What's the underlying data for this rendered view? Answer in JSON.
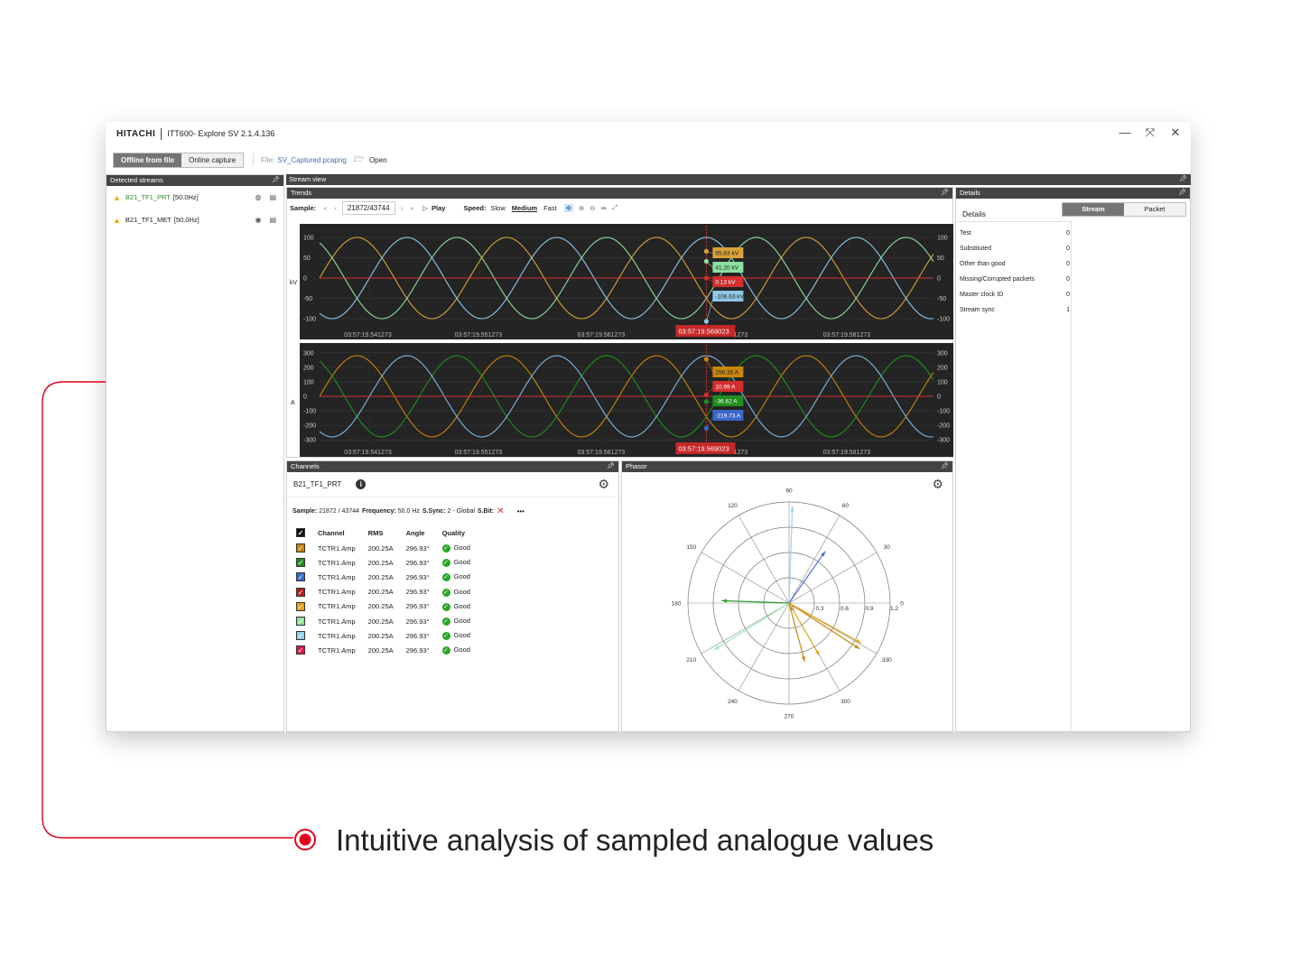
{
  "app": {
    "brand": "HITACHI",
    "title": "ITT600- Explore SV 2.1.4.136",
    "window_controls": {
      "minimize": "—",
      "restore": "⤧",
      "close": "✕"
    }
  },
  "toolbar": {
    "offline_label": "Offline from file",
    "online_label": "Online capture",
    "file_label": "File:",
    "file_name": "SV_Captured.pcapng",
    "open_label": "Open"
  },
  "detected_streams": {
    "header": "Detected streams",
    "items": [
      {
        "name": "B21_TF1_PRT",
        "freq": "[50.0Hz]"
      },
      {
        "name": "B21_TF1_MET",
        "freq": "[50.0Hz]"
      }
    ]
  },
  "stream_view": {
    "header": "Stream view",
    "trends_header": "Trends",
    "sample_label": "Sample:",
    "sample_value": "21872/43744",
    "play_label": "Play",
    "speed_label": "Speed:",
    "speed_slow": "Slow",
    "speed_medium": "Medium",
    "speed_fast": "Fast"
  },
  "channels": {
    "header": "Channels",
    "stream_name": "B21_TF1_PRT",
    "info_sample_label": "Sample:",
    "info_sample_value": "21872 / 43744",
    "info_freq_label": "Frequency:",
    "info_freq_value": "50.0 Hz",
    "info_ssync_label": "S.Sync:",
    "info_ssync_value": "2 - Global",
    "info_sbit_label": "S.Bit:",
    "more": "•••",
    "columns": [
      "Channel",
      "RMS",
      "Angle",
      "Quality"
    ],
    "rows": [
      {
        "color": "#c8860c",
        "channel": "TCTR1.Amp",
        "rms": "200.25A",
        "angle": "296.93°",
        "quality": "Good"
      },
      {
        "color": "#1f8f1f",
        "channel": "TCTR1.Amp",
        "rms": "200.25A",
        "angle": "296.93°",
        "quality": "Good"
      },
      {
        "color": "#3a68c8",
        "channel": "TCTR1.Amp",
        "rms": "200.25A",
        "angle": "296.93°",
        "quality": "Good"
      },
      {
        "color": "#b71c1c",
        "channel": "TCTR1.Amp",
        "rms": "200.25A",
        "angle": "296.93°",
        "quality": "Good"
      },
      {
        "color": "#e2a31c",
        "channel": "TCTR1.Amp",
        "rms": "200.25A",
        "angle": "296.93°",
        "quality": "Good"
      },
      {
        "color": "#8ee39a",
        "channel": "TCTR1.Amp",
        "rms": "200.25A",
        "angle": "296.93°",
        "quality": "Good"
      },
      {
        "color": "#8fd0ee",
        "channel": "TCTR1.Amp",
        "rms": "200.25A",
        "angle": "296.93°",
        "quality": "Good"
      },
      {
        "color": "#d81b45",
        "channel": "TCTR1.Amp",
        "rms": "200.25A",
        "angle": "296.93°",
        "quality": "Good"
      }
    ]
  },
  "phasor": {
    "header": "Phasor",
    "angle_labels": [
      "0",
      "30",
      "60",
      "90",
      "120",
      "150",
      "180",
      "210",
      "240",
      "270",
      "300",
      "330"
    ],
    "radial_labels": [
      "0",
      "0.3",
      "0.6",
      "0.9",
      "1.2"
    ],
    "vectors": [
      {
        "angle": 88,
        "mag": 1.15,
        "color": "#9fd0f5"
      },
      {
        "angle": 55,
        "mag": 0.75,
        "color": "#4a6fd8"
      },
      {
        "angle": 178,
        "mag": 0.8,
        "color": "#2e9b2e"
      },
      {
        "angle": 212,
        "mag": 1.05,
        "color": "#9ee8b0"
      },
      {
        "angle": 285,
        "mag": 0.72,
        "color": "#c8860c"
      },
      {
        "angle": 300,
        "mag": 0.72,
        "color": "#e2a31c"
      },
      {
        "angle": 327,
        "mag": 1.0,
        "color": "#c8860c"
      },
      {
        "angle": 331,
        "mag": 0.98,
        "color": "#e2a31c"
      }
    ]
  },
  "details": {
    "header": "Details",
    "title": "Details",
    "tab_stream": "Stream",
    "tab_packet": "Packet",
    "rows": [
      {
        "k": "Test",
        "v": "0"
      },
      {
        "k": "Substituted",
        "v": "0"
      },
      {
        "k": "Other than good",
        "v": "0"
      },
      {
        "k": "Missing/Corrupted packets",
        "v": "0"
      },
      {
        "k": "Master clock ID",
        "v": "0"
      },
      {
        "k": "Stream sync",
        "v": "1"
      }
    ]
  },
  "chart_data": [
    {
      "type": "line",
      "ylabel": "kV",
      "ylim": [
        -120,
        120
      ],
      "yticks": [
        100,
        50,
        0,
        -50,
        -100
      ],
      "xticks": [
        "03:57:19.541273",
        "03:57:19.551273",
        "03:57:19.561273",
        "03:57:19.571273",
        "03:57:19.581273"
      ],
      "cursor_label": "03:57:19.569023",
      "series": [
        {
          "color": "#d8a23a",
          "amplitude": 100,
          "phase_deg": 0
        },
        {
          "color": "#8be0a0",
          "amplitude": 100,
          "phase_deg": 120
        },
        {
          "color": "#8fc8e8",
          "amplitude": 100,
          "phase_deg": 240
        },
        {
          "color": "#d32f2f",
          "amplitude": 0,
          "phase_deg": 0
        }
      ],
      "cursor_values": [
        {
          "text": "65.83 kV",
          "bg": "#d8a23a",
          "fg": "#222",
          "value": 65.83
        },
        {
          "text": "41.20 kV",
          "bg": "#8be0a0",
          "fg": "#222",
          "value": 41.2
        },
        {
          "text": "0.13 kV",
          "bg": "#d32f2f",
          "fg": "#fff",
          "value": 0.13
        },
        {
          "text": "-106.63 kV",
          "bg": "#8fc8e8",
          "fg": "#222",
          "value": -106.63
        }
      ]
    },
    {
      "type": "line",
      "ylabel": "A",
      "ylim": [
        -330,
        330
      ],
      "yticks": [
        300,
        200,
        100,
        0,
        -100,
        -200,
        -300
      ],
      "xticks": [
        "03:57:19.541273",
        "03:57:19.551273",
        "03:57:19.561273",
        "03:57:19.571273",
        "03:57:19.581273"
      ],
      "cursor_label": "03:57:19.569023",
      "series": [
        {
          "color": "#c8860c",
          "amplitude": 280,
          "phase_deg": 0
        },
        {
          "color": "#1f8f1f",
          "amplitude": 280,
          "phase_deg": 120
        },
        {
          "color": "#7fb8e0",
          "amplitude": 280,
          "phase_deg": 240
        },
        {
          "color": "#d32f2f",
          "amplitude": 0,
          "phase_deg": 0
        }
      ],
      "cursor_values": [
        {
          "text": "256.35 A",
          "bg": "#c8860c",
          "fg": "#222",
          "value": 256.35
        },
        {
          "text": "10.99 A",
          "bg": "#d32f2f",
          "fg": "#fff",
          "value": 10.99
        },
        {
          "text": "-36.62 A",
          "bg": "#1f8f1f",
          "fg": "#fff",
          "value": -36.62
        },
        {
          "text": "-219.73 A",
          "bg": "#3a68c8",
          "fg": "#fff",
          "value": -219.73
        }
      ]
    }
  ],
  "tagline": "Intuitive analysis of sampled analogue values"
}
